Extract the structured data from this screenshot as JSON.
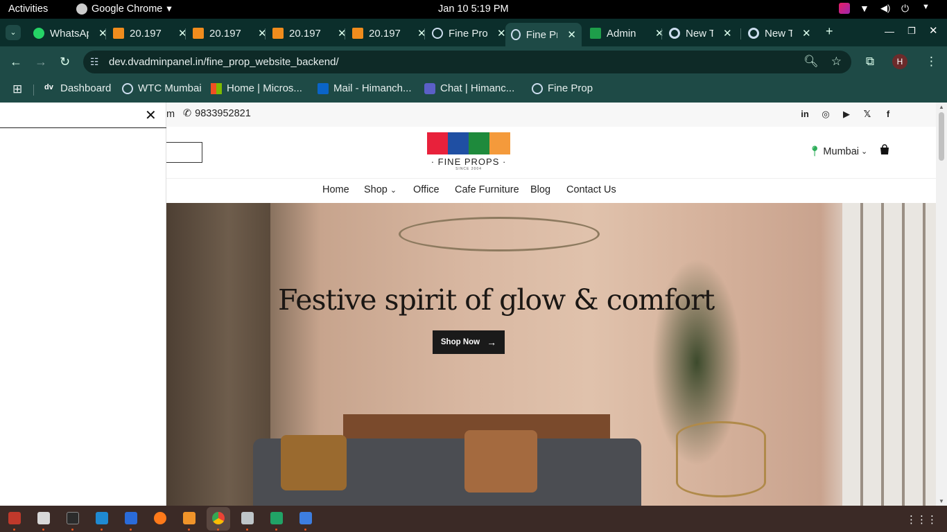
{
  "system": {
    "activities": "Activities",
    "app_name": "Google Chrome",
    "clock": "Jan 10  5:19 PM"
  },
  "tabs": [
    {
      "title": "WhatsApp",
      "icon": "whatsapp-icon"
    },
    {
      "title": "20.197",
      "icon": "vlc-icon"
    },
    {
      "title": "20.197",
      "icon": "vlc-icon"
    },
    {
      "title": "20.197",
      "icon": "vlc-icon"
    },
    {
      "title": "20.197",
      "icon": "vlc-icon"
    },
    {
      "title": "Fine Props",
      "icon": "globe-icon"
    },
    {
      "title": "Fine Props",
      "icon": "globe-icon",
      "active": true
    },
    {
      "title": "Admin",
      "icon": "sheets-icon"
    },
    {
      "title": "New Tab",
      "icon": "chrome-icon"
    },
    {
      "title": "New Tab",
      "icon": "chrome-icon"
    }
  ],
  "omnibox": {
    "url": "dev.dvadminpanel.in/fine_prop_website_backend/"
  },
  "profile_initial": "H",
  "bookmarks": [
    {
      "label": "Dashboard",
      "icon": "dv-icon"
    },
    {
      "label": "WTC Mumbai",
      "icon": "globe-icon"
    },
    {
      "label": "Home | Micros...",
      "icon": "microsoft-icon"
    },
    {
      "label": "Mail - Himanch...",
      "icon": "outlook-icon"
    },
    {
      "label": "Chat | Himanc...",
      "icon": "teams-icon"
    },
    {
      "label": "Fine Prop",
      "icon": "globe-icon"
    }
  ],
  "site": {
    "email_fragment": "m",
    "phone": "9833952821",
    "logo_word": "· FINE PROPS ·",
    "logo_since": "SINCE 2004",
    "city": "Mumbai",
    "nav": [
      "Home",
      "Shop",
      "Office",
      "Cafe Furniture",
      "Blog",
      "Contact Us"
    ],
    "hero_title": "Festive spirit of glow & comfort",
    "hero_button": "Shop Now"
  },
  "colors": {
    "chrome_dark": "#0b2e2b",
    "chrome_toolbar": "#1e4a46",
    "logo_red": "#e8213b",
    "logo_blue": "#1f4fa3",
    "logo_green": "#1e8a3c",
    "logo_orange": "#f49a3b"
  }
}
